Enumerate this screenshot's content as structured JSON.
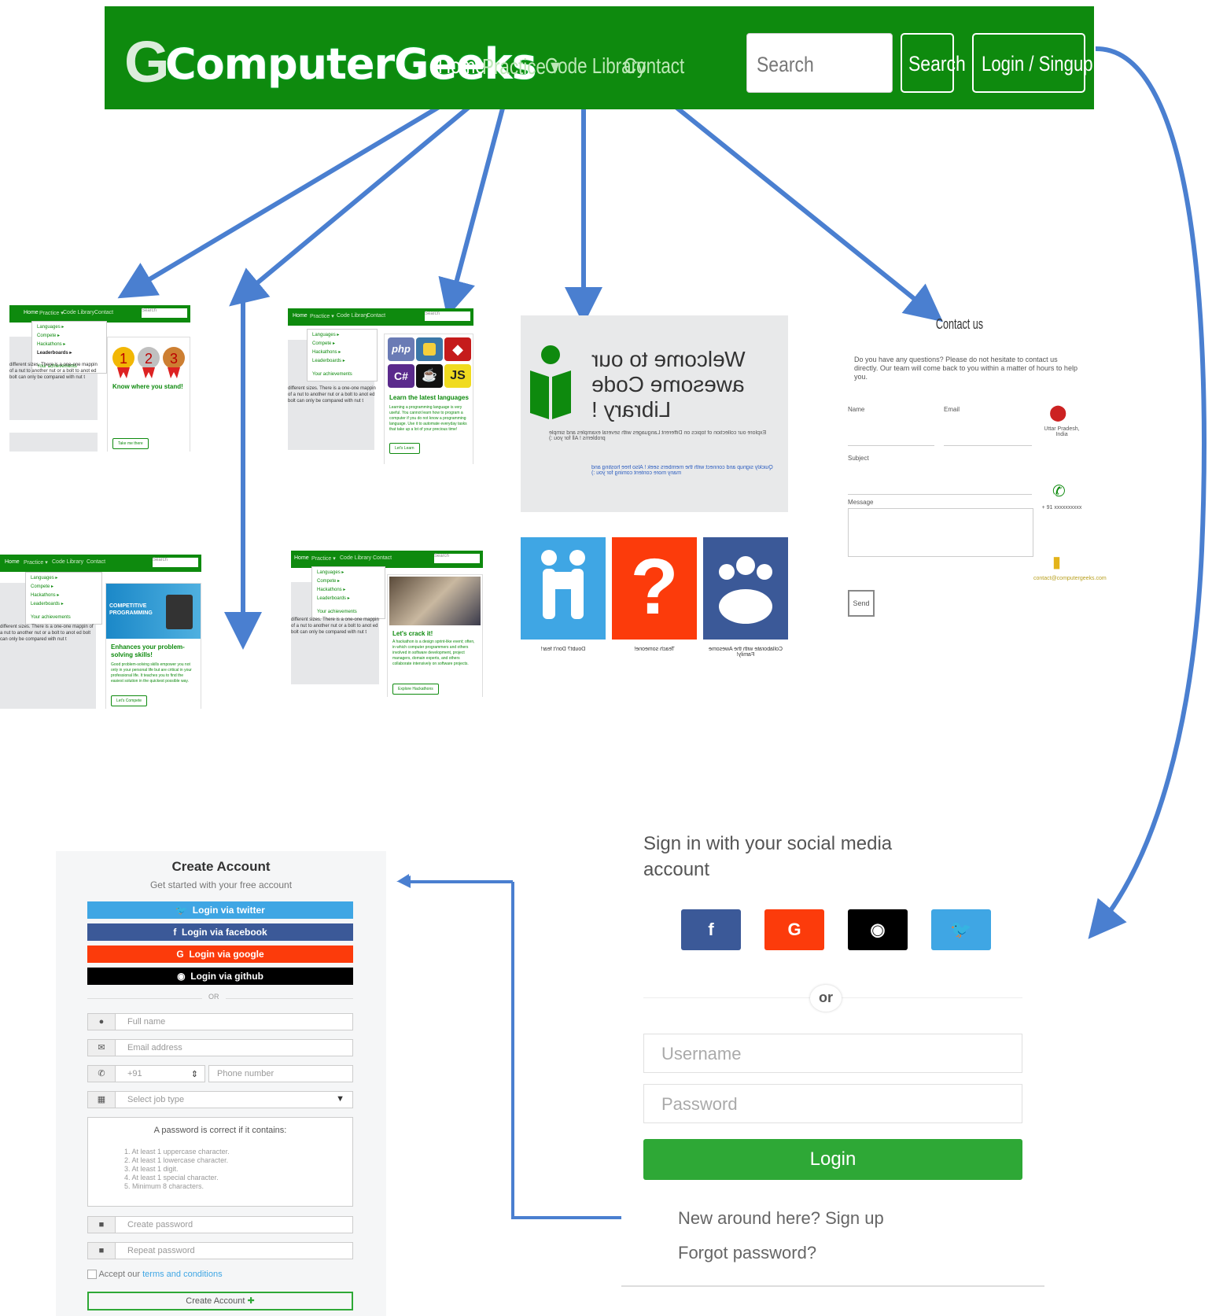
{
  "colors": {
    "brand_green": "#0e8a0e",
    "arrow_blue": "#4a7fd0",
    "twitter": "#3fa6e4",
    "facebook": "#3b5998",
    "google": "#fc3b0b",
    "github": "#000000",
    "login_green": "#2ea836"
  },
  "navbar": {
    "logo_g": "G",
    "logo_text": "ComputerGeeks",
    "links": [
      "Home",
      "Practice ▾",
      "Code Library",
      "Contact"
    ],
    "search_placeholder": "Search",
    "search_button": "Search",
    "login_button": "Login / Singup ›"
  },
  "thumbs": {
    "nav_links": [
      "Home",
      "Practice ▾",
      "Code Library",
      "Contact"
    ],
    "search": "Search",
    "menu": [
      "Languages ▸",
      "Compete ▸",
      "Hackathons ▸",
      "Leaderboards ▸",
      "Your achievements"
    ],
    "body_text": "different sizes. There is a one-one mappin of a nut to another nut or a bolt to anot ed bolt can only be compared with nut t",
    "leaderboard": {
      "title": "Know where you stand!",
      "button": "Take me there"
    },
    "languages": {
      "title": "Learn the latest languages",
      "text": "Learning a programming language is very useful. You cannot learn how to program a computer if you do not know a programming language. Use it to automate everyday tasks that take up a lot of your precious time!",
      "button": "Let's Learn",
      "icons": [
        "php",
        "C#",
        "JS"
      ]
    },
    "compete": {
      "banner": "COMPETITIVE PROGRAMMING",
      "title": "Enhances your problem-solving skills!",
      "text": "Good problem-solving skills empower you not only in your personal life but are critical in your professional life. It teaches you to find the easiest solution in the quickest possible way.",
      "button": "Let's Compete"
    },
    "hackathon": {
      "title": "Let's crack it!",
      "text": "A hackathon is a design sprint-like event; often, in which computer programmers and others involved in software development, project managers, domain experts, and others collaborate intensively on software projects.",
      "button": "Explore Hackathons"
    }
  },
  "code_library": {
    "title": "Welcome to our awesome Code Library !",
    "subtitle": "Explore our collection of topics on Different Languages with several examples and simple problems ! All for you :)",
    "note": "Quickly signup and connect with the members seek ! Also free hosting and many more content coming for you :)",
    "captions": [
      "Doubt? Don't fear!",
      "Teach someone!",
      "Collaborate with the Awesome Family!"
    ]
  },
  "contact": {
    "title": "Contact us",
    "intro": "Do you have any questions? Please do not hesitate to contact us directly. Our team will come back to you within a matter of hours to help you.",
    "labels": [
      "Name",
      "Email",
      "Subject",
      "Message"
    ],
    "button": "Send",
    "info": [
      "Uttar Pradesh, India",
      "+ 91 xxxxxxxxxx",
      "contact@computergeeks.com"
    ]
  },
  "create_account": {
    "title": "Create Account",
    "subtitle": "Get started with your free account",
    "social": [
      {
        "label": "Login via twitter",
        "icon": "twitter-icon",
        "glyph": "🐦"
      },
      {
        "label": "Login via facebook",
        "icon": "facebook-icon",
        "glyph": "f"
      },
      {
        "label": "Login via google",
        "icon": "google-icon",
        "glyph": "G"
      },
      {
        "label": "Login via github",
        "icon": "github-icon",
        "glyph": "◉"
      }
    ],
    "or": "OR",
    "full_name": "Full name",
    "email": "Email address",
    "country_code": "+91",
    "phone": "Phone number",
    "job_type": "Select job type",
    "pw_rules_title": "A password is correct if it contains:",
    "pw_rules": [
      "1. At least 1 uppercase character.",
      "2. At least 1 lowercase character.",
      "3. At least 1 digit.",
      "4. At least 1 special character.",
      "5. Minimum 8 characters."
    ],
    "create_password": "Create password",
    "repeat_password": "Repeat password",
    "accept": "Accept our",
    "terms": "terms and conditions",
    "submit": "Create Account"
  },
  "login": {
    "heading": "Sign in with your social media account",
    "social": [
      "f",
      "G",
      "◉",
      "🐦"
    ],
    "or": "or",
    "username": "Username",
    "password": "Password",
    "button": "Login",
    "signup_link": "New around here? Sign up",
    "forgot_link": "Forgot password?"
  }
}
